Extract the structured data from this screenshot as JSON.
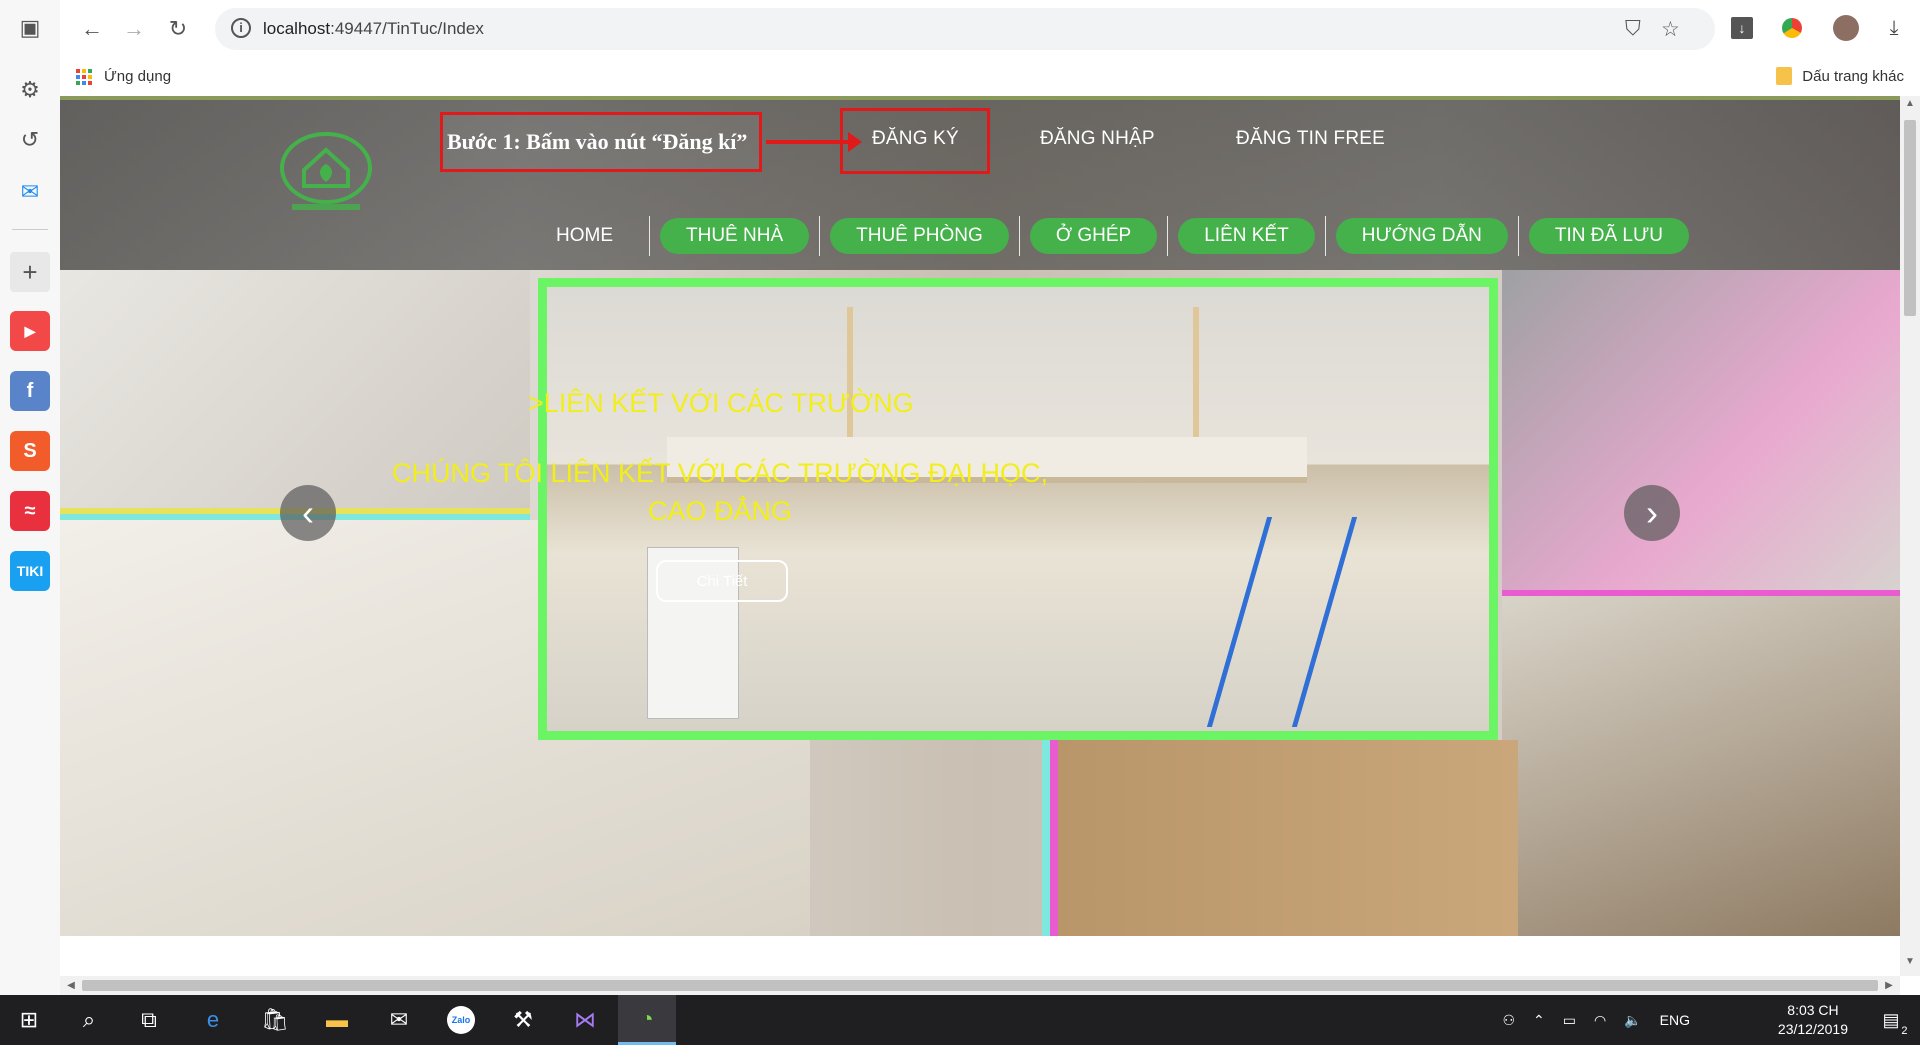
{
  "browser": {
    "url_host": "localhost",
    "url_path": ":49447/TinTuc/Index",
    "bookmarks_apps_label": "Ứng dụng",
    "bookmarks_other_label": "Dấu trang khác"
  },
  "sidebar": {
    "apps": [
      {
        "name": "youtube",
        "color": "#f24848",
        "glyph": "▶"
      },
      {
        "name": "facebook",
        "color": "#5a84c9",
        "glyph": "f"
      },
      {
        "name": "shopee",
        "color": "#f25b2a",
        "glyph": "S"
      },
      {
        "name": "lazada",
        "color": "#e8303e",
        "glyph": "≈"
      },
      {
        "name": "tiki",
        "color": "#1aa0f0",
        "glyph": "TIKI"
      }
    ]
  },
  "annotation": {
    "text": "Bước 1: Bấm vào nút “Đăng kí”"
  },
  "header": {
    "top_links": [
      "ĐĂNG KÝ",
      "ĐĂNG NHẬP",
      "ĐĂNG TIN FREE"
    ],
    "menu": [
      "HOME",
      "THUÊ NHÀ",
      "THUÊ PHÒNG",
      "Ở GHÉP",
      "LIÊN KẾT",
      "HƯỚNG DẪN",
      "TIN ĐÃ LƯU"
    ]
  },
  "carousel": {
    "caption_title": ">LIÊN KẾT VỚI CÁC TRƯỜNG",
    "caption_line1": "CHÚNG TÔI LIÊN KẾT VỚI CÁC TRƯỜNG ĐẠI HỌC,",
    "caption_line2": "CAO ĐẲNG",
    "button_label": "Chi Tiết"
  },
  "taskbar": {
    "language": "ENG",
    "time": "8:03 CH",
    "date": "23/12/2019",
    "notifications": "2"
  },
  "colors": {
    "accent_green": "#44b14a",
    "caption_yellow": "#f2ee1c",
    "annotation_red": "#e01a1a",
    "frame_green": "#6bf564"
  }
}
